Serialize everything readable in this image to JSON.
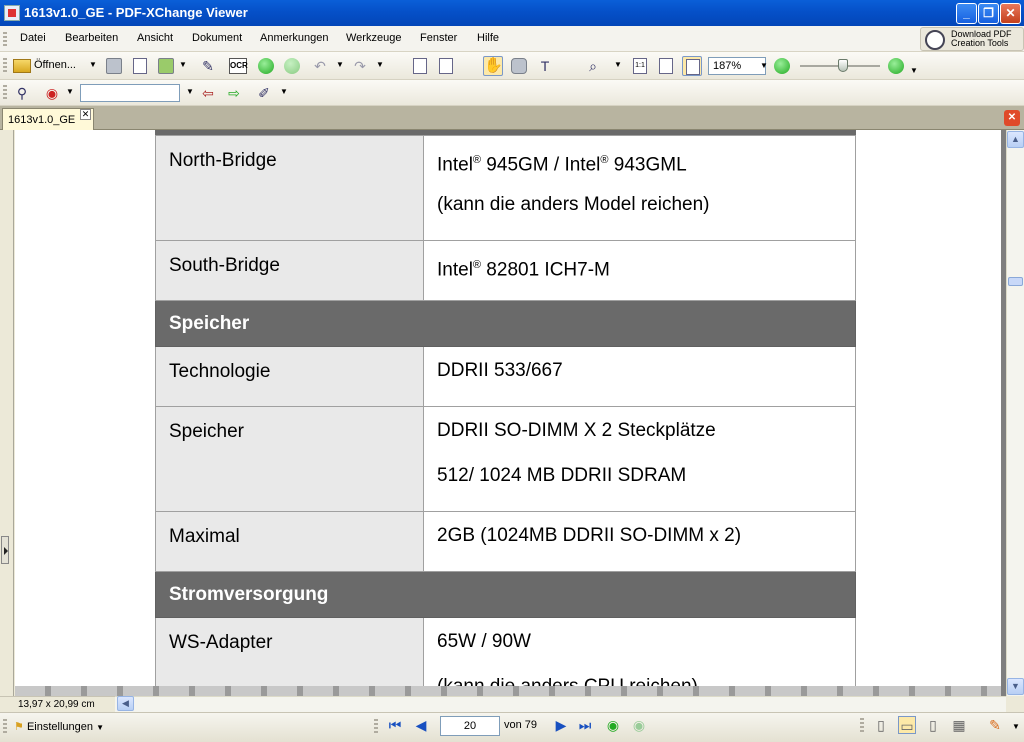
{
  "window": {
    "title": "1613v1.0_GE - PDF-XChange Viewer",
    "buttons": {
      "minimize": "_",
      "maximize": "❐",
      "close": "✕"
    }
  },
  "menu": [
    "Datei",
    "Bearbeiten",
    "Ansicht",
    "Dokument",
    "Anmerkungen",
    "Werkzeuge",
    "Fenster",
    "Hilfe"
  ],
  "promo": {
    "line1": "Download PDF",
    "line2": "Creation Tools"
  },
  "toolbar": {
    "open_label": "Öffnen...",
    "ocr_label": "OCR",
    "zoom_value": "187%",
    "zoom_slider_level": 0.55,
    "search_value": ""
  },
  "tab": {
    "label": "1613v1.0_GE",
    "close": "✕"
  },
  "document": {
    "rows": [
      {
        "type": "pair",
        "key": "North-Bridge",
        "lines": [
          "Intel® 945GM / Intel® 943GML",
          "(kann die anders Model reichen)"
        ]
      },
      {
        "type": "pair",
        "key": "South-Bridge",
        "lines": [
          "Intel® 82801 ICH7-M"
        ]
      },
      {
        "type": "section",
        "title": "Speicher"
      },
      {
        "type": "pair",
        "key": "Technologie",
        "lines": [
          "DDRII 533/667"
        ]
      },
      {
        "type": "pair",
        "key": "Speicher",
        "lines": [
          "DDRII SO-DIMM X 2 Steckplätze",
          "512/ 1024 MB DDRII SDRAM"
        ]
      },
      {
        "type": "pair",
        "key": "Maximal",
        "lines": [
          "2GB (1024MB DDRII SO-DIMM x 2)"
        ]
      },
      {
        "type": "section",
        "title": "Stromversorgung"
      },
      {
        "type": "pair",
        "key": "WS-Adapter",
        "lines": [
          "65W / 90W",
          "(kann die anders CPU reichen)"
        ]
      }
    ]
  },
  "status": {
    "page_size": "13,97 x 20,99 cm",
    "settings_label": "Einstellungen",
    "current_page": "20",
    "page_of": "von 79"
  }
}
